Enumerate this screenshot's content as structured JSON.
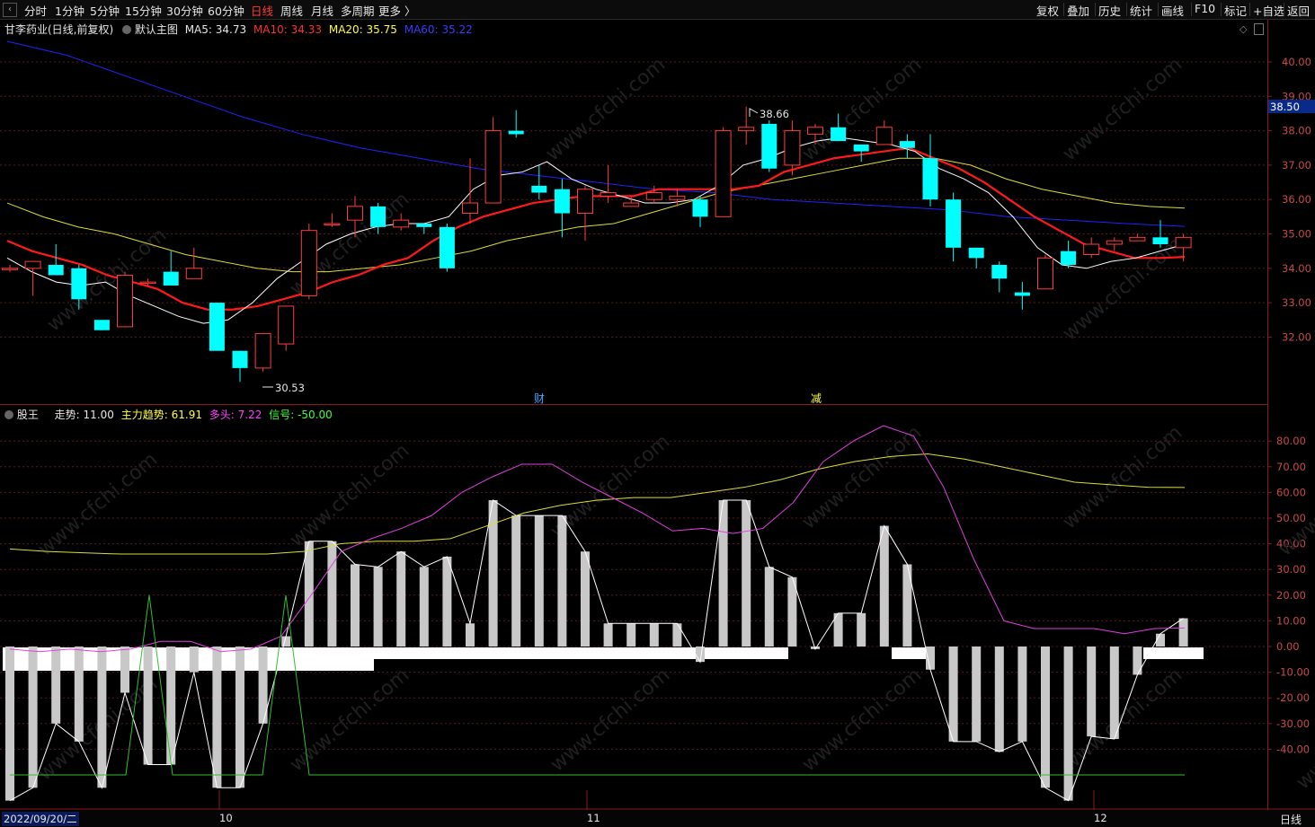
{
  "toolbar": {
    "back_icon": "back-arrow-icon",
    "timeframes": [
      "分时",
      "1分钟",
      "5分钟",
      "15分钟",
      "30分钟",
      "60分钟",
      "日线",
      "周线",
      "月线",
      "多周期",
      "更多 〉"
    ],
    "active_timeframe": "日线",
    "right_buttons": [
      "复权",
      "叠加",
      "历史",
      "统计",
      "画线",
      "F10",
      "标记",
      "+自选",
      "返回"
    ]
  },
  "main_panel": {
    "stock": "甘李药业(日线,前复权)",
    "chart_name": "默认主图",
    "ma5": {
      "label": "MA5:",
      "value": "34.73",
      "color": "#ffffff"
    },
    "ma10": {
      "label": "MA10:",
      "value": "34.33",
      "color": "#ff2020"
    },
    "ma20": {
      "label": "MA20:",
      "value": "35.75",
      "color": "#ffff40"
    },
    "ma60": {
      "label": "MA60:",
      "value": "35.22",
      "color": "#2020ff"
    },
    "y_ticks": [
      "40.00",
      "39.00",
      "38.00",
      "37.00",
      "36.00",
      "35.00",
      "34.00",
      "33.00",
      "32.00"
    ],
    "current_price": "38.50",
    "high_marker": "38.66",
    "low_marker": "30.53",
    "event_labels": [
      "财",
      "减"
    ]
  },
  "sub_panel": {
    "name": "股王",
    "trend": {
      "label": "走势:",
      "value": "11.00",
      "color": "#e6e6e6"
    },
    "main_trend": {
      "label": "主力趋势:",
      "value": "61.91",
      "color": "#ffff40"
    },
    "bull": {
      "label": "多头:",
      "value": "7.22",
      "color": "#ff40ff"
    },
    "signal": {
      "label": "信号:",
      "value": "-50.00",
      "color": "#40ff40"
    },
    "y_ticks": [
      "80.00",
      "70.00",
      "60.00",
      "50.00",
      "40.00",
      "30.00",
      "20.00",
      "10.00",
      "0.00",
      "-10.00",
      "-20.00",
      "-30.00",
      "-40.00"
    ]
  },
  "x_axis": {
    "start_date": "2022/09/20/二",
    "month_labels": [
      "10",
      "11",
      "12"
    ],
    "period": "日线"
  },
  "watermark": "www.cfchi.com",
  "chart_data": {
    "type": "candlestick",
    "candles": [
      [
        34.0,
        34.0,
        34.1,
        33.9
      ],
      [
        34.0,
        34.2,
        34.2,
        33.2
      ],
      [
        34.1,
        33.8,
        34.7,
        33.8
      ],
      [
        34.0,
        33.1,
        34.1,
        32.8
      ],
      [
        32.5,
        32.2,
        32.5,
        32.2
      ],
      [
        32.3,
        33.8,
        33.9,
        32.3
      ],
      [
        33.6,
        33.6,
        33.7,
        33.5
      ],
      [
        33.9,
        33.5,
        34.5,
        33.5
      ],
      [
        33.7,
        34.0,
        34.6,
        33.7
      ],
      [
        33.0,
        31.6,
        33.0,
        31.6
      ],
      [
        31.6,
        31.1,
        31.6,
        30.7
      ],
      [
        31.1,
        32.1,
        32.1,
        31.0
      ],
      [
        31.8,
        32.9,
        32.9,
        31.6
      ],
      [
        33.2,
        35.1,
        35.3,
        33.1
      ],
      [
        35.3,
        35.3,
        35.6,
        35.2
      ],
      [
        35.4,
        35.8,
        36.1,
        34.9
      ],
      [
        35.8,
        35.2,
        35.9,
        35.0
      ],
      [
        35.2,
        35.4,
        35.6,
        35.1
      ],
      [
        35.3,
        35.2,
        35.3,
        35.0
      ],
      [
        35.2,
        34.0,
        35.3,
        33.9
      ],
      [
        35.6,
        35.9,
        37.2,
        35.3
      ],
      [
        35.9,
        38.0,
        38.4,
        35.9
      ],
      [
        38.0,
        37.9,
        38.6,
        37.8
      ],
      [
        36.4,
        36.2,
        37.0,
        36.0
      ],
      [
        36.3,
        35.6,
        36.6,
        34.9
      ],
      [
        35.6,
        36.3,
        36.4,
        34.8
      ],
      [
        36.1,
        36.2,
        37.0,
        35.9
      ],
      [
        35.8,
        35.9,
        36.1,
        35.8
      ],
      [
        36.0,
        36.2,
        36.4,
        35.9
      ],
      [
        36.0,
        36.1,
        36.3,
        35.8
      ],
      [
        36.0,
        35.5,
        36.1,
        35.2
      ],
      [
        35.5,
        38.0,
        38.1,
        35.5
      ],
      [
        38.0,
        38.1,
        38.7,
        37.6
      ],
      [
        38.2,
        36.9,
        38.3,
        36.8
      ],
      [
        37.0,
        38.0,
        38.3,
        36.7
      ],
      [
        37.9,
        38.1,
        38.2,
        37.6
      ],
      [
        38.1,
        37.7,
        38.5,
        37.7
      ],
      [
        37.6,
        37.4,
        37.6,
        37.1
      ],
      [
        37.6,
        38.1,
        38.3,
        37.6
      ],
      [
        37.7,
        37.5,
        37.9,
        37.2
      ],
      [
        37.2,
        36.0,
        37.9,
        35.8
      ],
      [
        36.0,
        34.6,
        36.2,
        34.2
      ],
      [
        34.6,
        34.3,
        34.6,
        34.0
      ],
      [
        34.1,
        33.7,
        34.2,
        33.3
      ],
      [
        33.3,
        33.2,
        33.6,
        32.8
      ],
      [
        33.4,
        34.3,
        34.4,
        33.4
      ],
      [
        34.5,
        34.1,
        34.8,
        34.0
      ],
      [
        34.4,
        34.7,
        34.9,
        34.3
      ],
      [
        34.7,
        34.8,
        34.9,
        34.5
      ],
      [
        34.8,
        34.9,
        35.0,
        34.8
      ],
      [
        34.9,
        34.7,
        35.4,
        34.6
      ],
      [
        34.6,
        34.9,
        35.0,
        34.2
      ]
    ],
    "ma5": [
      34.3,
      33.9,
      33.6,
      33.5,
      33.6,
      33.2,
      32.9,
      32.6,
      32.4,
      32.5,
      33.0,
      33.7,
      34.2,
      34.7,
      35.0,
      35.2,
      35.3,
      35.3,
      35.5,
      36.3,
      36.7,
      36.8,
      37.1,
      36.6,
      36.3,
      36.1,
      35.9,
      35.9,
      36.0,
      36.4,
      37.0,
      37.2,
      37.5,
      37.7,
      37.8,
      37.7,
      37.6,
      37.4,
      36.9,
      36.6,
      36.2,
      35.5,
      34.6,
      34.1,
      34.0,
      34.2,
      34.3,
      34.5,
      34.7
    ],
    "ma10": [
      34.8,
      34.5,
      34.3,
      34.1,
      33.8,
      33.6,
      33.4,
      33.0,
      32.8,
      32.8,
      32.9,
      33.1,
      33.3,
      33.6,
      33.8,
      34.1,
      34.3,
      34.8,
      35.2,
      35.5,
      35.7,
      35.9,
      36.0,
      36.1,
      36.1,
      36.1,
      36.3,
      36.3,
      36.3,
      36.3,
      36.4,
      36.8,
      37.0,
      37.2,
      37.3,
      37.4,
      37.5,
      37.2,
      36.9,
      36.5,
      36.0,
      35.5,
      35.1,
      34.7,
      34.5,
      34.3,
      34.3,
      34.33
    ],
    "ma20": [
      35.9,
      35.5,
      35.2,
      35.0,
      34.7,
      34.4,
      34.2,
      34.0,
      33.9,
      33.9,
      34.0,
      34.1,
      34.3,
      34.5,
      34.8,
      35.0,
      35.2,
      35.3,
      35.6,
      35.9,
      36.2,
      36.4,
      36.6,
      36.8,
      37.0,
      37.2,
      37.2,
      37.0,
      36.6,
      36.3,
      36.1,
      35.9,
      35.8,
      35.75
    ],
    "ma60": [
      40.6,
      40.2,
      39.6,
      39.0,
      38.4,
      37.9,
      37.5,
      37.2,
      36.9,
      36.7,
      36.5,
      36.3,
      36.2,
      36.0,
      35.9,
      35.8,
      35.7,
      35.5,
      35.4,
      35.3,
      35.22
    ],
    "trend_bars": [
      -60,
      -55,
      -30,
      -37,
      -55,
      -18,
      -46,
      -46,
      -10,
      -55,
      -55,
      -30,
      4,
      41,
      41,
      32,
      31,
      37,
      31,
      35,
      9,
      57,
      51,
      51,
      51,
      37,
      9,
      9,
      9,
      9,
      -6,
      57,
      57,
      31,
      27,
      -1,
      13,
      13,
      47,
      32,
      -9,
      -37,
      -37,
      -41,
      -37,
      -55,
      -60,
      -35,
      -36,
      -11,
      5,
      11
    ],
    "main_trend_line": [
      38,
      37,
      36.5,
      36,
      36,
      36,
      36,
      36,
      37,
      40,
      41,
      41,
      42,
      47,
      52,
      55,
      57,
      58,
      58,
      60,
      62,
      65,
      69,
      72,
      74,
      75,
      73,
      70,
      67,
      64,
      63,
      62,
      61.91
    ],
    "bull_line": [
      -1,
      -2,
      -1,
      -2,
      -1,
      2,
      2,
      -2,
      -1,
      4,
      20,
      37,
      42,
      46,
      51,
      60,
      66,
      71,
      71,
      64,
      58,
      52,
      45,
      46,
      44,
      46,
      56,
      72,
      80,
      86,
      82,
      62,
      34,
      10,
      7,
      7,
      7,
      5,
      7,
      7.22
    ],
    "signal_line": [
      -50,
      -50,
      -50,
      -50,
      -50,
      -50,
      20,
      -50,
      -50,
      -50,
      -50,
      -50,
      20,
      -50,
      -50,
      -50,
      -50
    ]
  }
}
